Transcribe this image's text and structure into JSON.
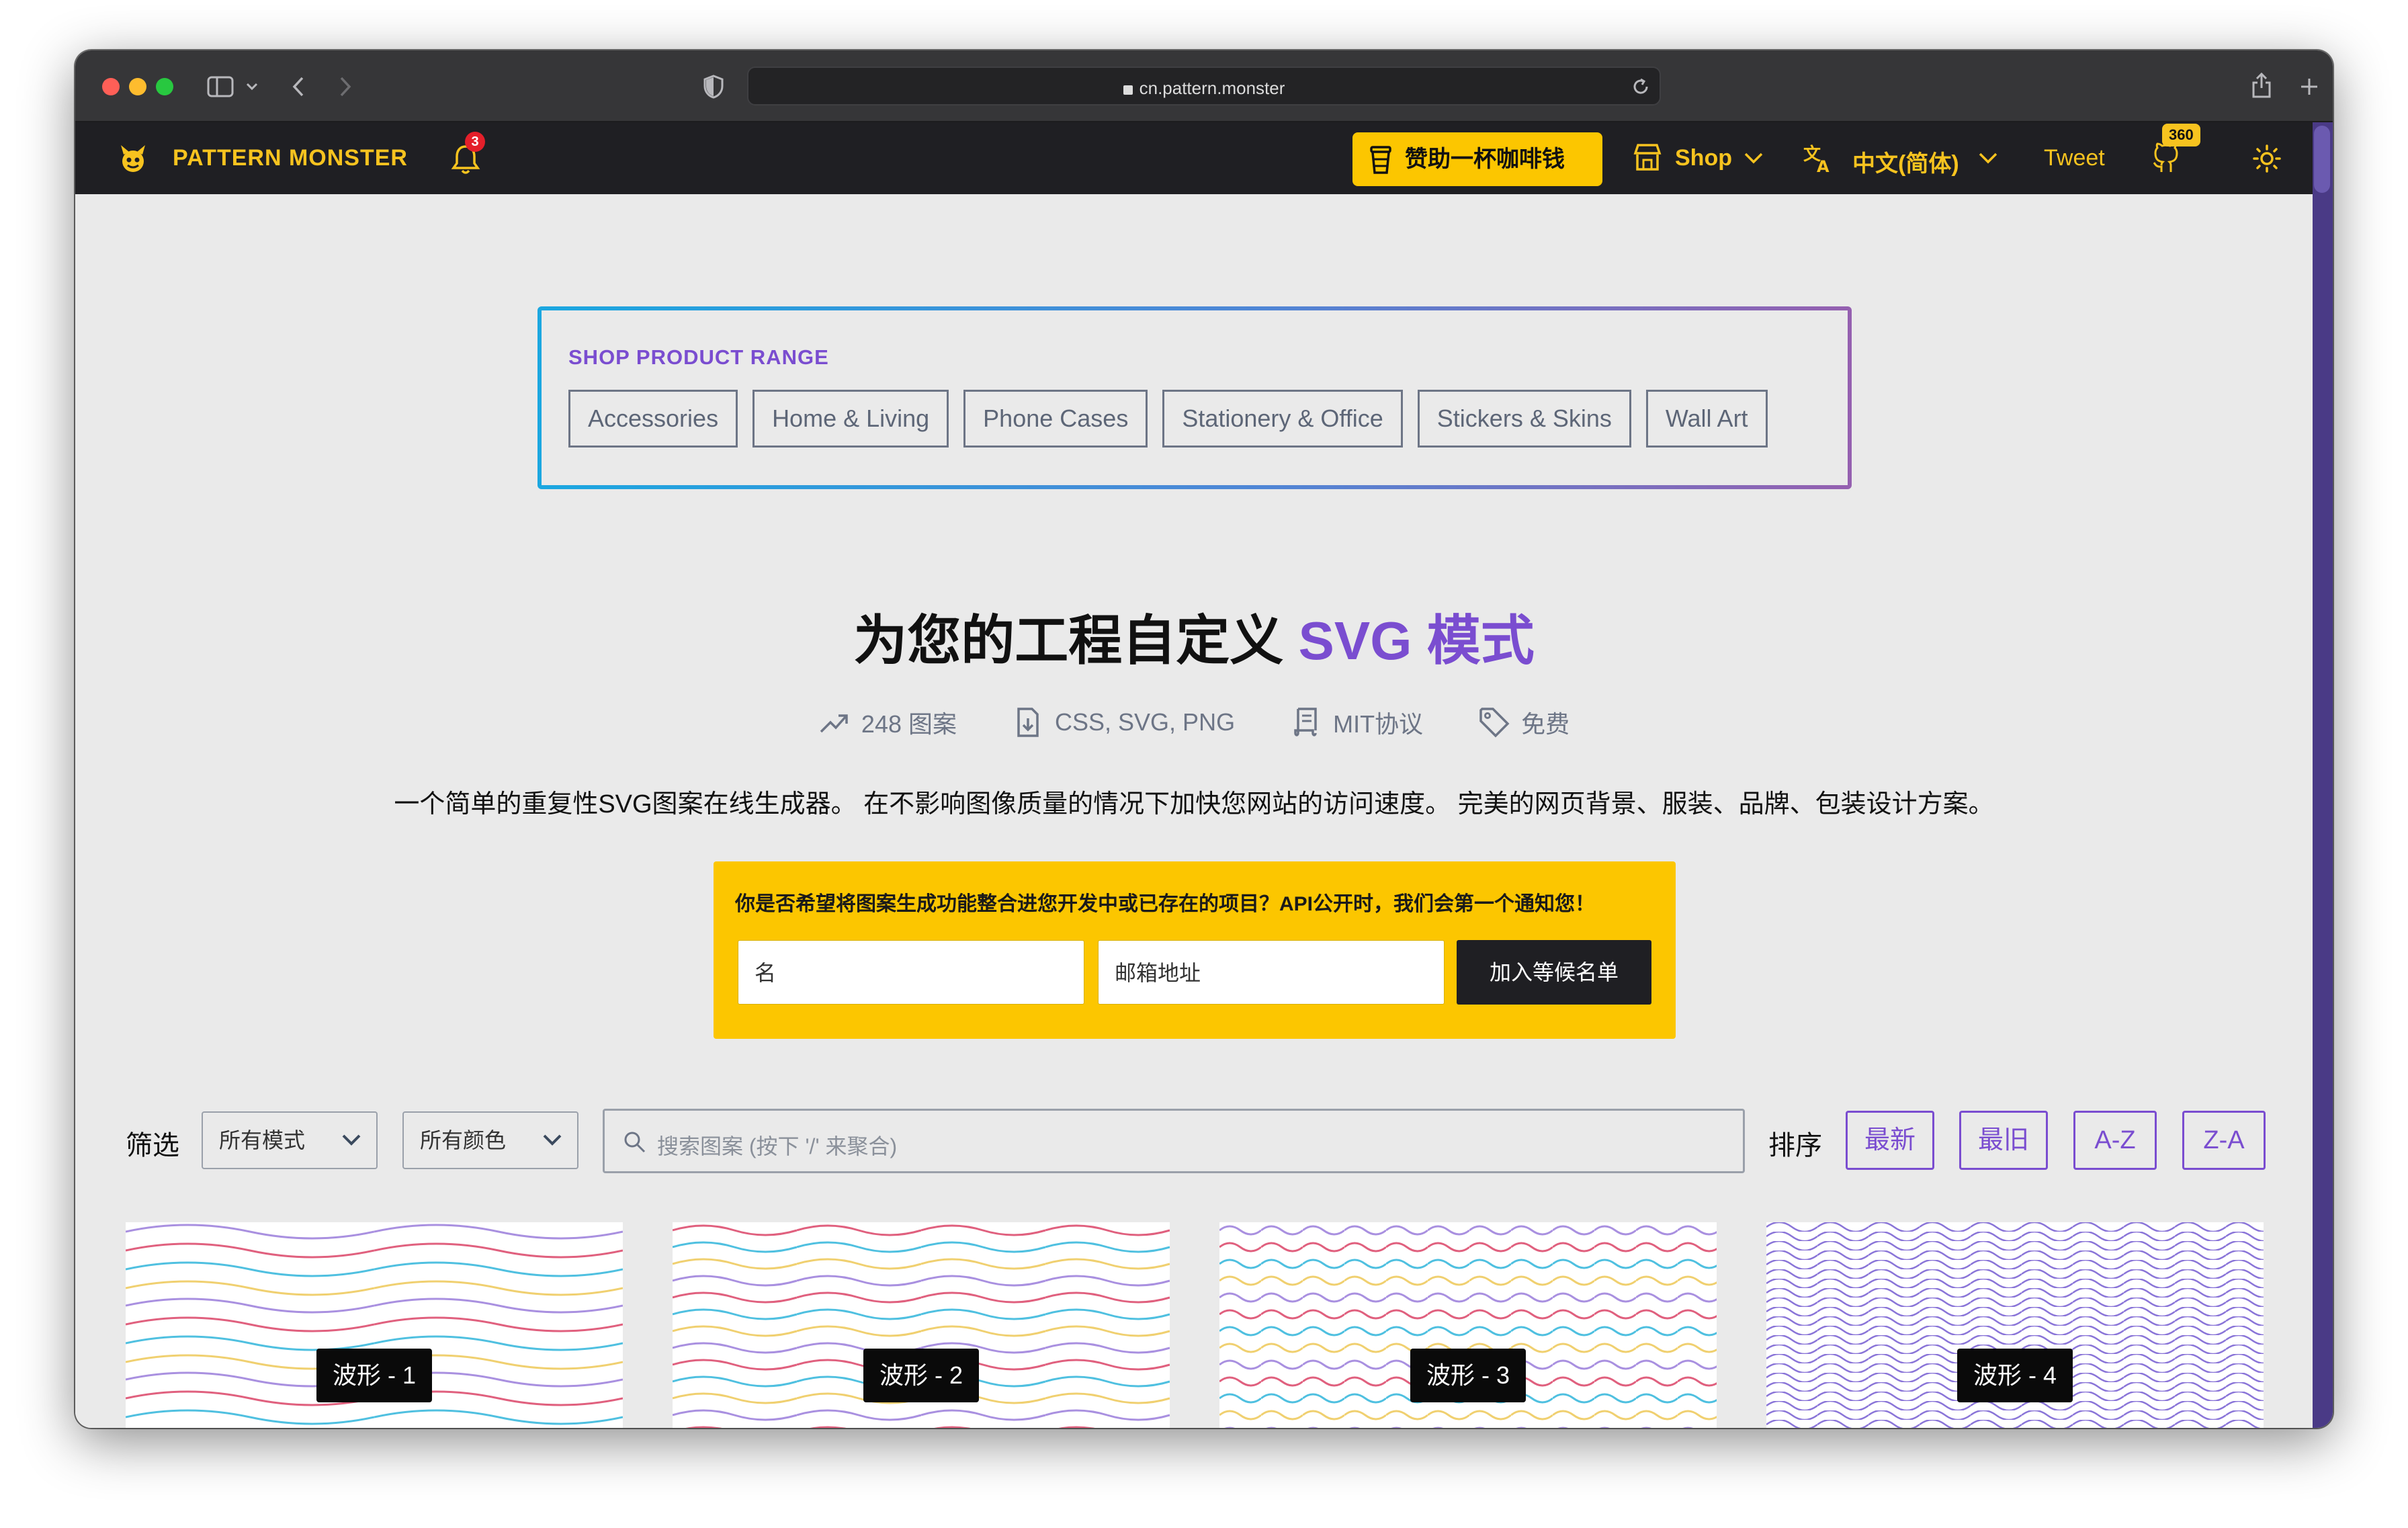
{
  "browser": {
    "url": "cn.pattern.monster"
  },
  "nav": {
    "logo": "PATTERN MONSTER",
    "notification_count": "3",
    "coffee_label": "赞助一杯咖啡钱",
    "shop_label": "Shop",
    "language_label": "中文(简体)",
    "tweet_label": "Tweet",
    "github_stars": "360"
  },
  "shop_range": {
    "title": "SHOP PRODUCT RANGE",
    "tags": [
      "Accessories",
      "Home & Living",
      "Phone Cases",
      "Stationery & Office",
      "Stickers & Skins",
      "Wall Art"
    ]
  },
  "hero": {
    "title_main": "为您的工程自定义 ",
    "title_accent": "SVG 模式",
    "stats": [
      "248 图案",
      "CSS, SVG, PNG",
      "MIT协议",
      "免费"
    ],
    "tagline": "一个简单的重复性SVG图案在线生成器。 在不影响图像质量的情况下加快您网站的访问速度。 完美的网页背景、服装、品牌、包装设计方案。"
  },
  "waitlist": {
    "text": "你是否希望将图案生成功能整合进您开发中或已存在的项目？API公开时，我们会第一个通知您！",
    "name_placeholder": "名",
    "email_placeholder": "邮箱地址",
    "button": "加入等候名单"
  },
  "filters": {
    "label": "筛选",
    "mode_select": "所有模式",
    "color_select": "所有颜色",
    "search_placeholder": "搜索图案 (按下 '/' 来聚合)",
    "sort_label": "排序",
    "sort_options": [
      "最新",
      "最旧",
      "A-Z",
      "Z-A"
    ]
  },
  "patterns": [
    {
      "label": "波形 - 1"
    },
    {
      "label": "波形 - 2"
    },
    {
      "label": "波形 - 3"
    },
    {
      "label": "波形 - 4"
    }
  ],
  "colors": {
    "accent_purple": "#7a4dd0",
    "brand_yellow": "#f7c31f",
    "waitlist_yellow": "#fcc600",
    "nav_bg": "#1f1f23"
  }
}
